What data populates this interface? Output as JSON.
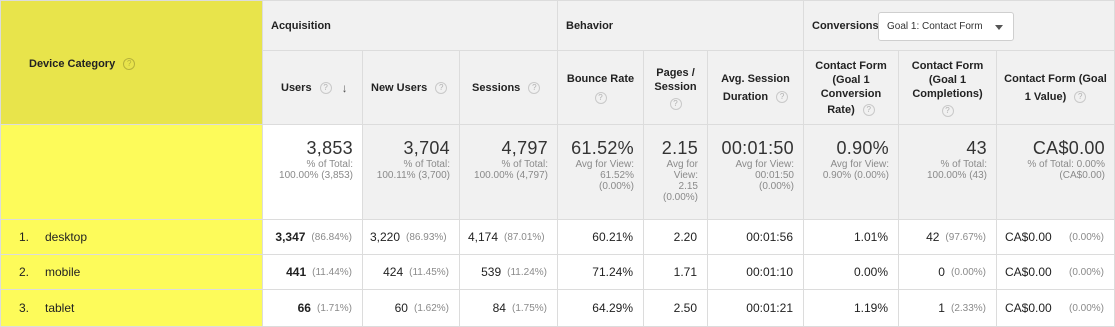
{
  "header": {
    "dimension_label": "Device Category",
    "groups": {
      "acquisition": "Acquisition",
      "behavior": "Behavior",
      "conversions": "Conversions"
    },
    "goal_select": "Goal 1: Contact Form",
    "columns": {
      "users": "Users",
      "new_users": "New Users",
      "sessions": "Sessions",
      "bounce_rate": "Bounce Rate",
      "pages_session_l1": "Pages /",
      "pages_session_l2": "Session",
      "avg_duration_l1": "Avg. Session",
      "avg_duration_l2": "Duration",
      "conv_rate_l1": "Contact Form",
      "conv_rate_l2": "(Goal 1",
      "conv_rate_l3": "Conversion",
      "conv_rate_l4": "Rate)",
      "completions_l1": "Contact Form",
      "completions_l2": "(Goal 1",
      "completions_l3": "Completions)",
      "value_l1": "Contact Form (Goal",
      "value_l2": "1 Value)"
    },
    "help_glyph": "?",
    "sort_glyph": "↓"
  },
  "summary": {
    "users": {
      "value": "3,853",
      "l1": "% of Total:",
      "l2": "100.00% (3,853)"
    },
    "new_users": {
      "value": "3,704",
      "l1": "% of Total:",
      "l2": "100.11% (3,700)"
    },
    "sessions": {
      "value": "4,797",
      "l1": "% of Total:",
      "l2": "100.00% (4,797)"
    },
    "bounce_rate": {
      "value": "61.52%",
      "l1": "Avg for View:",
      "l2": "61.52%",
      "l3": "(0.00%)"
    },
    "pages_session": {
      "value": "2.15",
      "l1": "Avg for",
      "l2": "View:",
      "l3": "2.15",
      "l4": "(0.00%)"
    },
    "avg_duration": {
      "value": "00:01:50",
      "l1": "Avg for View:",
      "l2": "00:01:50",
      "l3": "(0.00%)"
    },
    "conv_rate": {
      "value": "0.90%",
      "l1": "Avg for View:",
      "l2": "0.90% (0.00%)"
    },
    "completions": {
      "value": "43",
      "l1": "% of Total:",
      "l2": "100.00% (43)"
    },
    "goal_value": {
      "value": "CA$0.00",
      "l1": "% of Total: 0.00%",
      "l2": "(CA$0.00)"
    }
  },
  "rows": [
    {
      "index": "1.",
      "device": "desktop",
      "users": "3,347",
      "users_pct": "(86.84%)",
      "new_users": "3,220",
      "new_users_pct": "(86.93%)",
      "sessions": "4,174",
      "sessions_pct": "(87.01%)",
      "bounce_rate": "60.21%",
      "pages_session": "2.20",
      "avg_duration": "00:01:56",
      "conv_rate": "1.01%",
      "completions": "42",
      "completions_pct": "(97.67%)",
      "goal_value": "CA$0.00",
      "goal_value_pct": "(0.00%)"
    },
    {
      "index": "2.",
      "device": "mobile",
      "users": "441",
      "users_pct": "(11.44%)",
      "new_users": "424",
      "new_users_pct": "(11.45%)",
      "sessions": "539",
      "sessions_pct": "(11.24%)",
      "bounce_rate": "71.24%",
      "pages_session": "1.71",
      "avg_duration": "00:01:10",
      "conv_rate": "0.00%",
      "completions": "0",
      "completions_pct": "(0.00%)",
      "goal_value": "CA$0.00",
      "goal_value_pct": "(0.00%)"
    },
    {
      "index": "3.",
      "device": "tablet",
      "users": "66",
      "users_pct": "(1.71%)",
      "new_users": "60",
      "new_users_pct": "(1.62%)",
      "sessions": "84",
      "sessions_pct": "(1.75%)",
      "bounce_rate": "64.29%",
      "pages_session": "2.50",
      "avg_duration": "00:01:21",
      "conv_rate": "1.19%",
      "completions": "1",
      "completions_pct": "(2.33%)",
      "goal_value": "CA$0.00",
      "goal_value_pct": "(0.00%)"
    }
  ],
  "colors": {
    "dimension_header_bg": "#e8e44b",
    "dimension_cell_bg": "#fdfb5a",
    "header_bg": "#f1f1f1",
    "border": "#dcdcdc"
  }
}
